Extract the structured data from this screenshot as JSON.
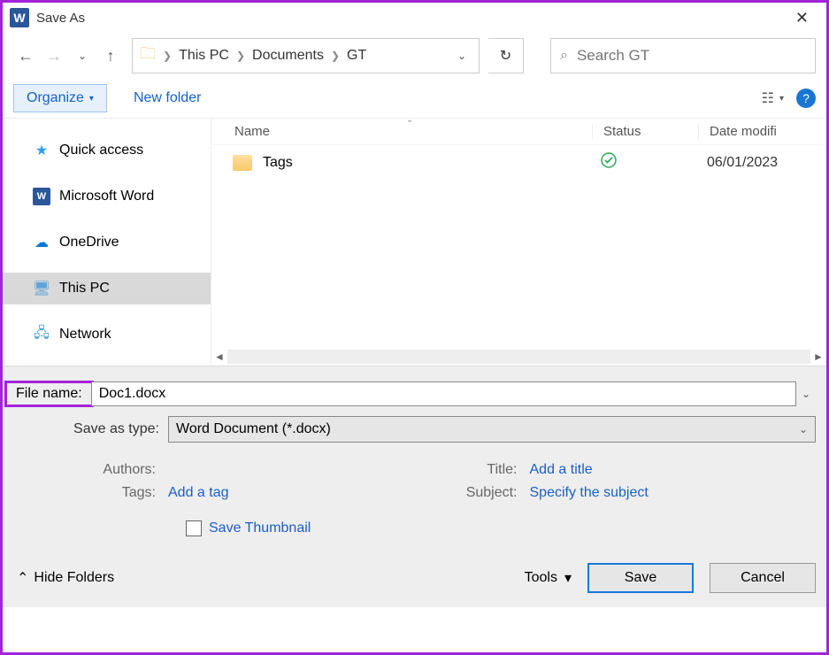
{
  "title": "Save As",
  "breadcrumb": [
    "This PC",
    "Documents",
    "GT"
  ],
  "search_placeholder": "Search GT",
  "toolbar": {
    "organize": "Organize",
    "new_folder": "New folder"
  },
  "sidebar": {
    "items": [
      {
        "label": "Quick access",
        "icon": "star"
      },
      {
        "label": "Microsoft Word",
        "icon": "word"
      },
      {
        "label": "OneDrive",
        "icon": "onedrive"
      },
      {
        "label": "This PC",
        "icon": "pc",
        "selected": true
      },
      {
        "label": "Network",
        "icon": "network"
      }
    ]
  },
  "columns": {
    "name": "Name",
    "status": "Status",
    "date": "Date modifi"
  },
  "rows": [
    {
      "name": "Tags",
      "status": "✓",
      "date": "06/01/2023"
    }
  ],
  "form": {
    "filename_label": "File name:",
    "filename_value": "Doc1.docx",
    "type_label": "Save as type:",
    "type_value": "Word Document (*.docx)"
  },
  "meta": {
    "authors_label": "Authors:",
    "authors_value": "",
    "tags_label": "Tags:",
    "tags_value": "Add a tag",
    "title_label": "Title:",
    "title_value": "Add a title",
    "subject_label": "Subject:",
    "subject_value": "Specify the subject"
  },
  "thumbnail_label": "Save Thumbnail",
  "actions": {
    "hide_folders": "Hide Folders",
    "tools": "Tools",
    "save": "Save",
    "cancel": "Cancel"
  }
}
